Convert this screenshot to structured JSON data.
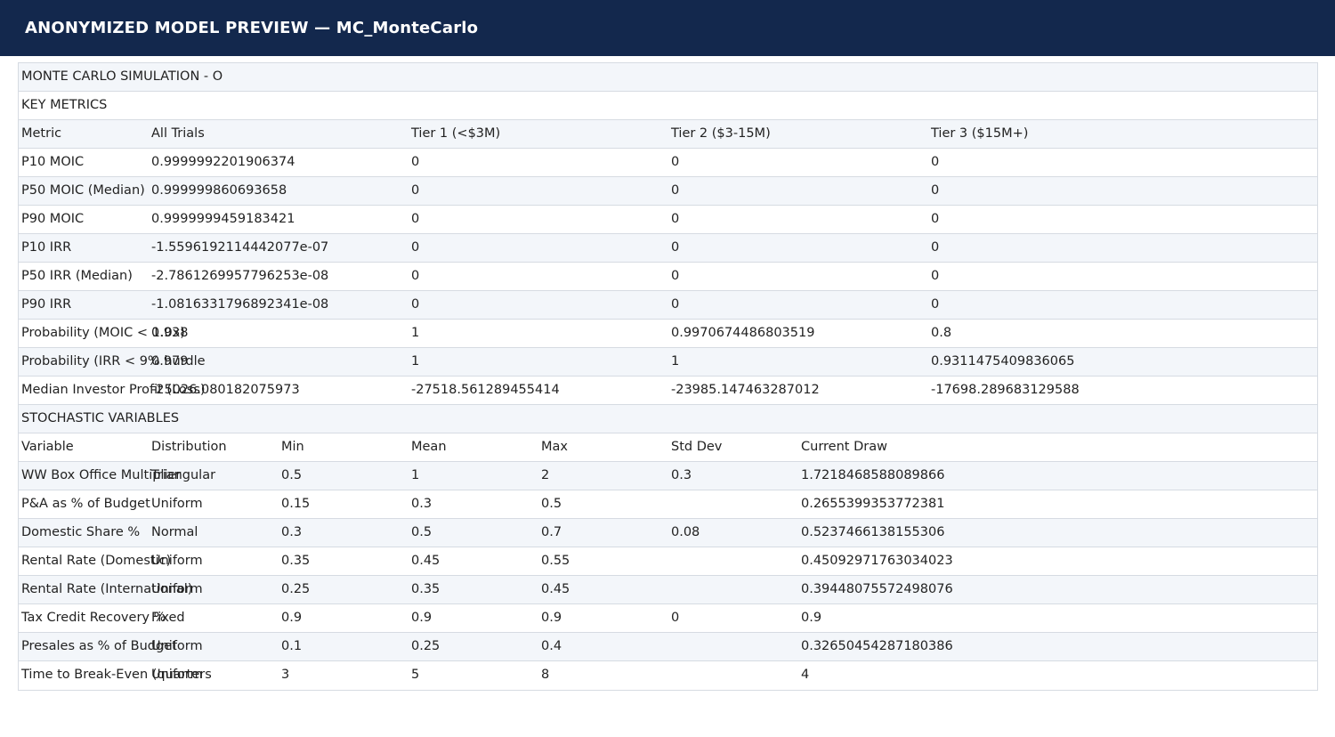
{
  "header": {
    "title": "ANONYMIZED MODEL PREVIEW — MC_MonteCarlo"
  },
  "sheet": {
    "rows": [
      {
        "cells": [
          {
            "col": 0,
            "text": "MONTE CARLO SIMULATION  -  O"
          }
        ]
      },
      {
        "cells": [
          {
            "col": 0,
            "text": "KEY METRICS"
          }
        ]
      },
      {
        "cells": [
          {
            "col": 0,
            "text": "Metric"
          },
          {
            "col": 1,
            "text": "All Trials"
          },
          {
            "col": 3,
            "text": "Tier 1 (<$3M)"
          },
          {
            "col": 5,
            "text": "Tier 2 ($3-15M)"
          },
          {
            "col": 7,
            "text": "Tier 3 ($15M+)"
          }
        ]
      },
      {
        "cells": [
          {
            "col": 0,
            "text": "P10 MOIC"
          },
          {
            "col": 1,
            "text": "0.9999992201906374"
          },
          {
            "col": 3,
            "text": "0"
          },
          {
            "col": 5,
            "text": "0"
          },
          {
            "col": 7,
            "text": "0"
          }
        ]
      },
      {
        "cells": [
          {
            "col": 0,
            "text": "P50 MOIC (Median)"
          },
          {
            "col": 1,
            "text": "0.999999860693658"
          },
          {
            "col": 3,
            "text": "0"
          },
          {
            "col": 5,
            "text": "0"
          },
          {
            "col": 7,
            "text": "0"
          }
        ]
      },
      {
        "cells": [
          {
            "col": 0,
            "text": "P90 MOIC"
          },
          {
            "col": 1,
            "text": "0.9999999459183421"
          },
          {
            "col": 3,
            "text": "0"
          },
          {
            "col": 5,
            "text": "0"
          },
          {
            "col": 7,
            "text": "0"
          }
        ]
      },
      {
        "cells": [
          {
            "col": 0,
            "text": "P10 IRR"
          },
          {
            "col": 1,
            "text": "-1.5596192114442077e-07"
          },
          {
            "col": 3,
            "text": "0"
          },
          {
            "col": 5,
            "text": "0"
          },
          {
            "col": 7,
            "text": "0"
          }
        ]
      },
      {
        "cells": [
          {
            "col": 0,
            "text": "P50 IRR (Median)"
          },
          {
            "col": 1,
            "text": "-2.7861269957796253e-08"
          },
          {
            "col": 3,
            "text": "0"
          },
          {
            "col": 5,
            "text": "0"
          },
          {
            "col": 7,
            "text": "0"
          }
        ]
      },
      {
        "cells": [
          {
            "col": 0,
            "text": "P90 IRR"
          },
          {
            "col": 1,
            "text": "-1.0816331796892341e-08"
          },
          {
            "col": 3,
            "text": "0"
          },
          {
            "col": 5,
            "text": "0"
          },
          {
            "col": 7,
            "text": "0"
          }
        ]
      },
      {
        "cells": [
          {
            "col": 0,
            "text": "Probability (MOIC < 1.0x)"
          },
          {
            "col": 1,
            "text": "0.938"
          },
          {
            "col": 3,
            "text": "1"
          },
          {
            "col": 5,
            "text": "0.9970674486803519"
          },
          {
            "col": 7,
            "text": "0.8"
          }
        ]
      },
      {
        "cells": [
          {
            "col": 0,
            "text": "Probability (IRR < 9% hurdle"
          },
          {
            "col": 1,
            "text": "0.979"
          },
          {
            "col": 3,
            "text": "1"
          },
          {
            "col": 5,
            "text": "1"
          },
          {
            "col": 7,
            "text": "0.9311475409836065"
          }
        ]
      },
      {
        "cells": [
          {
            "col": 0,
            "text": "Median Investor Profit (Loss)"
          },
          {
            "col": 1,
            "text": "-25026.080182075973"
          },
          {
            "col": 3,
            "text": "-27518.561289455414"
          },
          {
            "col": 5,
            "text": "-23985.147463287012"
          },
          {
            "col": 7,
            "text": "-17698.289683129588"
          }
        ]
      },
      {
        "cells": [
          {
            "col": 0,
            "text": "STOCHASTIC VARIABLES"
          }
        ]
      },
      {
        "cells": [
          {
            "col": 0,
            "text": "Variable"
          },
          {
            "col": 1,
            "text": "Distribution"
          },
          {
            "col": 2,
            "text": "Min"
          },
          {
            "col": 3,
            "text": "Mean"
          },
          {
            "col": 4,
            "text": "Max"
          },
          {
            "col": 5,
            "text": "Std Dev"
          },
          {
            "col": 6,
            "text": "Current Draw"
          }
        ]
      },
      {
        "cells": [
          {
            "col": 0,
            "text": "WW Box Office Multiplier"
          },
          {
            "col": 1,
            "text": "Triangular"
          },
          {
            "col": 2,
            "text": "0.5"
          },
          {
            "col": 3,
            "text": "1"
          },
          {
            "col": 4,
            "text": "2"
          },
          {
            "col": 5,
            "text": "0.3"
          },
          {
            "col": 6,
            "text": "1.7218468588089866"
          }
        ]
      },
      {
        "cells": [
          {
            "col": 0,
            "text": "P&A as % of Budget"
          },
          {
            "col": 1,
            "text": "Uniform"
          },
          {
            "col": 2,
            "text": "0.15"
          },
          {
            "col": 3,
            "text": "0.3"
          },
          {
            "col": 4,
            "text": "0.5"
          },
          {
            "col": 6,
            "text": "0.2655399353772381"
          }
        ]
      },
      {
        "cells": [
          {
            "col": 0,
            "text": "Domestic Share %"
          },
          {
            "col": 1,
            "text": "Normal"
          },
          {
            "col": 2,
            "text": "0.3"
          },
          {
            "col": 3,
            "text": "0.5"
          },
          {
            "col": 4,
            "text": "0.7"
          },
          {
            "col": 5,
            "text": "0.08"
          },
          {
            "col": 6,
            "text": "0.5237466138155306"
          }
        ]
      },
      {
        "cells": [
          {
            "col": 0,
            "text": "Rental Rate (Domestic)"
          },
          {
            "col": 1,
            "text": "Uniform"
          },
          {
            "col": 2,
            "text": "0.35"
          },
          {
            "col": 3,
            "text": "0.45"
          },
          {
            "col": 4,
            "text": "0.55"
          },
          {
            "col": 6,
            "text": "0.45092971763034023"
          }
        ]
      },
      {
        "cells": [
          {
            "col": 0,
            "text": "Rental Rate (International)"
          },
          {
            "col": 1,
            "text": "Uniform"
          },
          {
            "col": 2,
            "text": "0.25"
          },
          {
            "col": 3,
            "text": "0.35"
          },
          {
            "col": 4,
            "text": "0.45"
          },
          {
            "col": 6,
            "text": "0.39448075572498076"
          }
        ]
      },
      {
        "cells": [
          {
            "col": 0,
            "text": "Tax Credit Recovery %"
          },
          {
            "col": 1,
            "text": "Fixed"
          },
          {
            "col": 2,
            "text": "0.9"
          },
          {
            "col": 3,
            "text": "0.9"
          },
          {
            "col": 4,
            "text": "0.9"
          },
          {
            "col": 5,
            "text": "0"
          },
          {
            "col": 6,
            "text": "0.9"
          }
        ]
      },
      {
        "cells": [
          {
            "col": 0,
            "text": "Presales as % of Budget"
          },
          {
            "col": 1,
            "text": "Uniform"
          },
          {
            "col": 2,
            "text": "0.1"
          },
          {
            "col": 3,
            "text": "0.25"
          },
          {
            "col": 4,
            "text": "0.4"
          },
          {
            "col": 6,
            "text": "0.32650454287180386"
          }
        ]
      },
      {
        "cells": [
          {
            "col": 0,
            "text": "Time to Break-Even (quarters"
          },
          {
            "col": 1,
            "text": "Uniform"
          },
          {
            "col": 2,
            "text": "3"
          },
          {
            "col": 3,
            "text": "5"
          },
          {
            "col": 4,
            "text": "8"
          },
          {
            "col": 6,
            "text": "4"
          }
        ]
      }
    ]
  }
}
